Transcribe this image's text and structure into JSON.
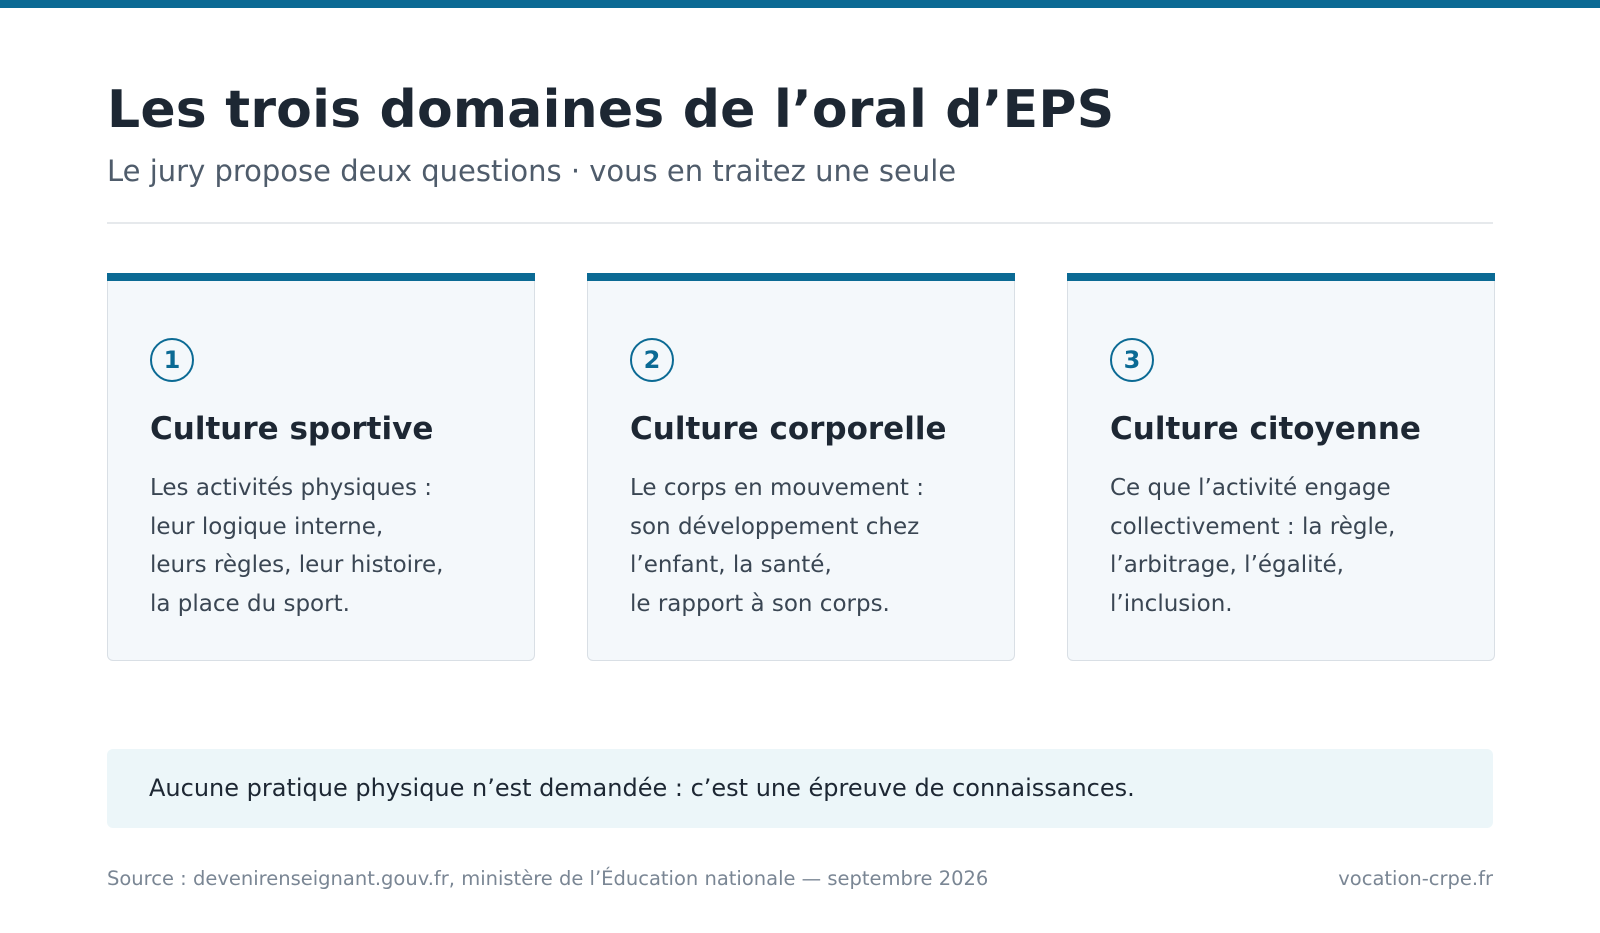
{
  "header": {
    "title": "Les trois domaines de l’oral d’EPS",
    "subtitle": "Le jury propose deux questions · vous en traitez une seule"
  },
  "cards": [
    {
      "number": "1",
      "title": "Culture sportive",
      "lines": [
        "Les activités physiques :",
        "leur logique interne,",
        "leurs règles, leur histoire,",
        "la place du sport."
      ]
    },
    {
      "number": "2",
      "title": "Culture corporelle",
      "lines": [
        "Le corps en mouvement :",
        "son développement chez",
        "l’enfant, la santé,",
        "le rapport à son corps."
      ]
    },
    {
      "number": "3",
      "title": "Culture citoyenne",
      "lines": [
        "Ce que l’activité engage",
        "collectivement : la règle,",
        "l’arbitrage, l’égalité,",
        "l’inclusion."
      ]
    }
  ],
  "note": "Aucune pratique physique n’est demandée : c’est une épreuve de connaissances.",
  "footer": {
    "source": "Source : devenirenseignant.gouv.fr, ministère de l’Éducation nationale — septembre 2026",
    "brand": "vocation-crpe.fr"
  },
  "colors": {
    "accent": "#0b6a94",
    "card_background": "#f4f8fb",
    "note_background": "#ecf6f9",
    "heading_text": "#1d2733"
  }
}
